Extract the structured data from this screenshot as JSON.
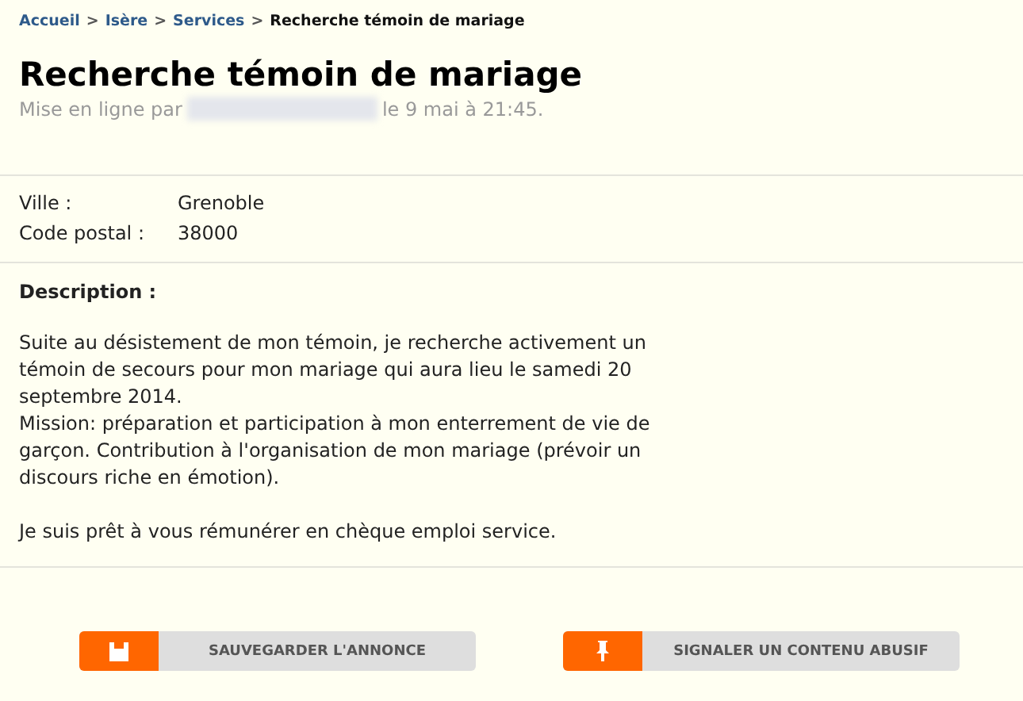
{
  "breadcrumb": [
    {
      "label": "Accueil",
      "current": false
    },
    {
      "label": "Isère",
      "current": false
    },
    {
      "label": "Services",
      "current": false
    },
    {
      "label": "Recherche témoin de mariage",
      "current": true
    }
  ],
  "breadcrumb_separator": ">",
  "title": "Recherche témoin de mariage",
  "posted": {
    "prefix": "Mise en ligne par",
    "suffix": "le 9 mai à 21:45."
  },
  "details": [
    {
      "label": "Ville :",
      "value": "Grenoble"
    },
    {
      "label": "Code postal :",
      "value": "38000"
    }
  ],
  "description": {
    "heading": "Description :",
    "paragraphs": [
      [
        "Suite au désistement de mon témoin, je recherche activement un témoin de secours pour mon mariage qui aura lieu le samedi 20 septembre 2014.",
        "Mission: préparation et participation à mon enterrement de vie de garçon. Contribution à l'organisation de mon mariage (prévoir un discours riche en émotion)."
      ],
      [
        "Je suis prêt à vous rémunérer en chèque emploi service."
      ]
    ]
  },
  "actions": [
    {
      "kind": "save",
      "label": "SAUVEGARDER L'ANNONCE"
    },
    {
      "kind": "report",
      "label": "SIGNALER UN CONTENU ABUSIF"
    }
  ]
}
